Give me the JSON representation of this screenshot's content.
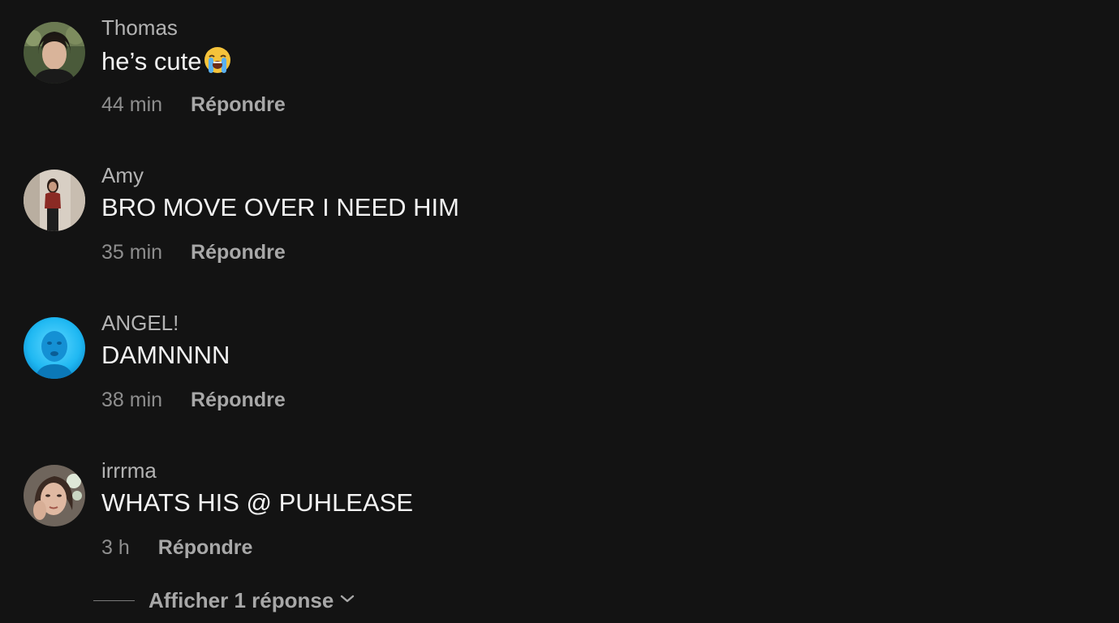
{
  "comments": [
    {
      "username": "Thomas",
      "text": "he’s cute",
      "emoji": "loudly-crying-face-icon",
      "time": "44 min",
      "reply_label": "Répondre"
    },
    {
      "username": "Amy",
      "text": "BRO MOVE OVER I NEED HIM",
      "time": "35 min",
      "reply_label": "Répondre"
    },
    {
      "username": "ANGEL!",
      "text": "DAMNNNN",
      "time": "38 min",
      "reply_label": "Répondre"
    },
    {
      "username": "irrrma",
      "text": "WHATS HIS @ PUHLEASE",
      "time": "3 h",
      "reply_label": "Répondre"
    }
  ],
  "show_replies": {
    "label": "Afficher 1 réponse",
    "icon": "chevron-down-icon"
  },
  "colors": {
    "background": "#131313",
    "username": "#b3b3b3",
    "text": "#f2f2f2",
    "meta": "#8e8e8e",
    "reply": "#a8a8a8"
  }
}
